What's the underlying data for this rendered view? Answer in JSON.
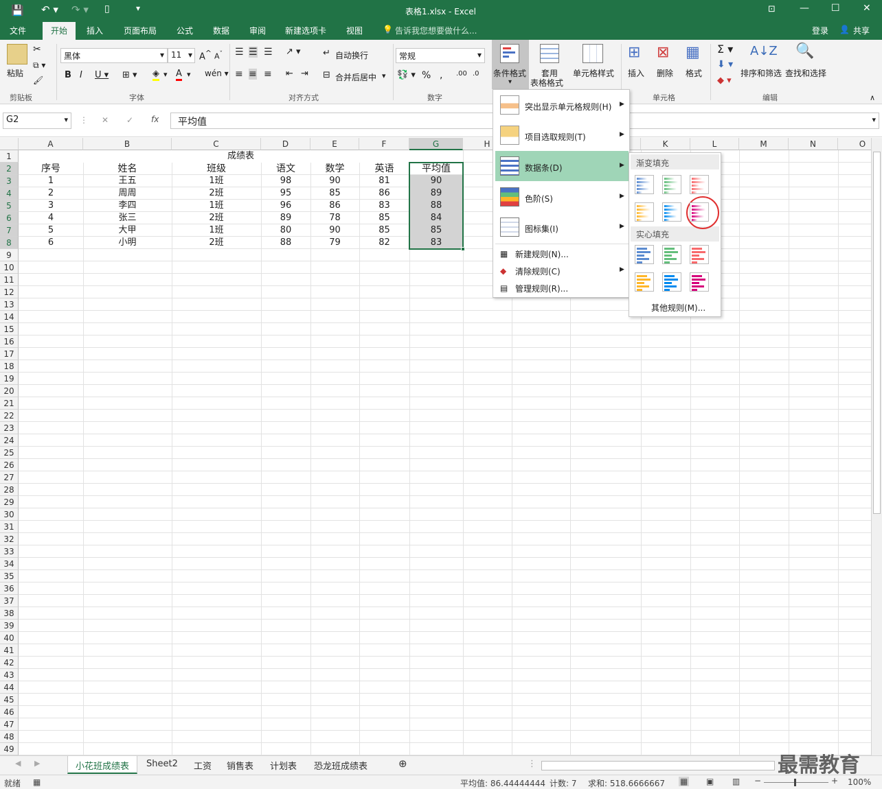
{
  "titlebar": {
    "title": "表格1.xlsx - Excel"
  },
  "tabs": [
    "文件",
    "开始",
    "插入",
    "页面布局",
    "公式",
    "数据",
    "审阅",
    "新建选项卡",
    "视图"
  ],
  "tell_me": "告诉我您想要做什么...",
  "login": "登录",
  "share": "共享",
  "ribbon": {
    "clipboard": {
      "paste": "粘贴",
      "label": "剪贴板"
    },
    "font": {
      "name": "黑体",
      "size": "11",
      "label": "字体"
    },
    "align": {
      "wrap": "自动换行",
      "merge": "合并后居中",
      "label": "对齐方式"
    },
    "number": {
      "format": "常规",
      "label": "数字"
    },
    "styles": {
      "cond": "条件格式",
      "table1": "套用",
      "table2": "表格格式",
      "cell": "单元格样式"
    },
    "cells": {
      "insert": "插入",
      "delete": "删除",
      "format": "格式",
      "label": "单元格"
    },
    "edit": {
      "sort": "排序和筛选",
      "find": "查找和选择",
      "label": "编辑"
    }
  },
  "formula": {
    "namebox": "G2",
    "fx": "fx",
    "content": "平均值"
  },
  "columns": [
    "A",
    "B",
    "C",
    "D",
    "E",
    "F",
    "G",
    "H",
    "I",
    "J",
    "K",
    "L",
    "M",
    "N",
    "O"
  ],
  "sheet": {
    "title": "成绩表",
    "headers": [
      "序号",
      "姓名",
      "班级",
      "语文",
      "数学",
      "英语",
      "平均值"
    ],
    "rows": [
      [
        "1",
        "王五",
        "1班",
        "98",
        "90",
        "81",
        "90"
      ],
      [
        "2",
        "周周",
        "2班",
        "95",
        "85",
        "86",
        "89"
      ],
      [
        "3",
        "李四",
        "1班",
        "96",
        "86",
        "83",
        "88"
      ],
      [
        "4",
        "张三",
        "2班",
        "89",
        "78",
        "85",
        "84"
      ],
      [
        "5",
        "大甲",
        "1班",
        "80",
        "90",
        "85",
        "85"
      ],
      [
        "6",
        "小明",
        "2班",
        "88",
        "79",
        "82",
        "83"
      ]
    ]
  },
  "menu": {
    "items": [
      "突出显示单元格规则(H)",
      "项目选取规则(T)",
      "数据条(D)",
      "色阶(S)",
      "图标集(I)"
    ],
    "small": [
      "新建规则(N)...",
      "清除规则(C)",
      "管理规则(R)..."
    ]
  },
  "submenu": {
    "gradient": "渐变填充",
    "solid": "实心填充",
    "more": "其他规则(M)..."
  },
  "sheet_tabs": [
    "小花班成绩表",
    "Sheet2",
    "工资",
    "销售表",
    "计划表",
    "恐龙班成绩表"
  ],
  "status": {
    "ready": "就绪",
    "avg": "平均值: 86.44444444",
    "count": "计数: 7",
    "sum": "求和: 518.6666667",
    "zoom": "100%"
  },
  "watermark": "最需教育",
  "colors": {
    "excel_green": "#217346",
    "bar_blue": "#5b8bd0",
    "bar_green": "#63be7b",
    "bar_red": "#f8696b",
    "bar_orange": "#ffb628",
    "bar_lightblue": "#008aef",
    "bar_purple": "#d6007b"
  }
}
